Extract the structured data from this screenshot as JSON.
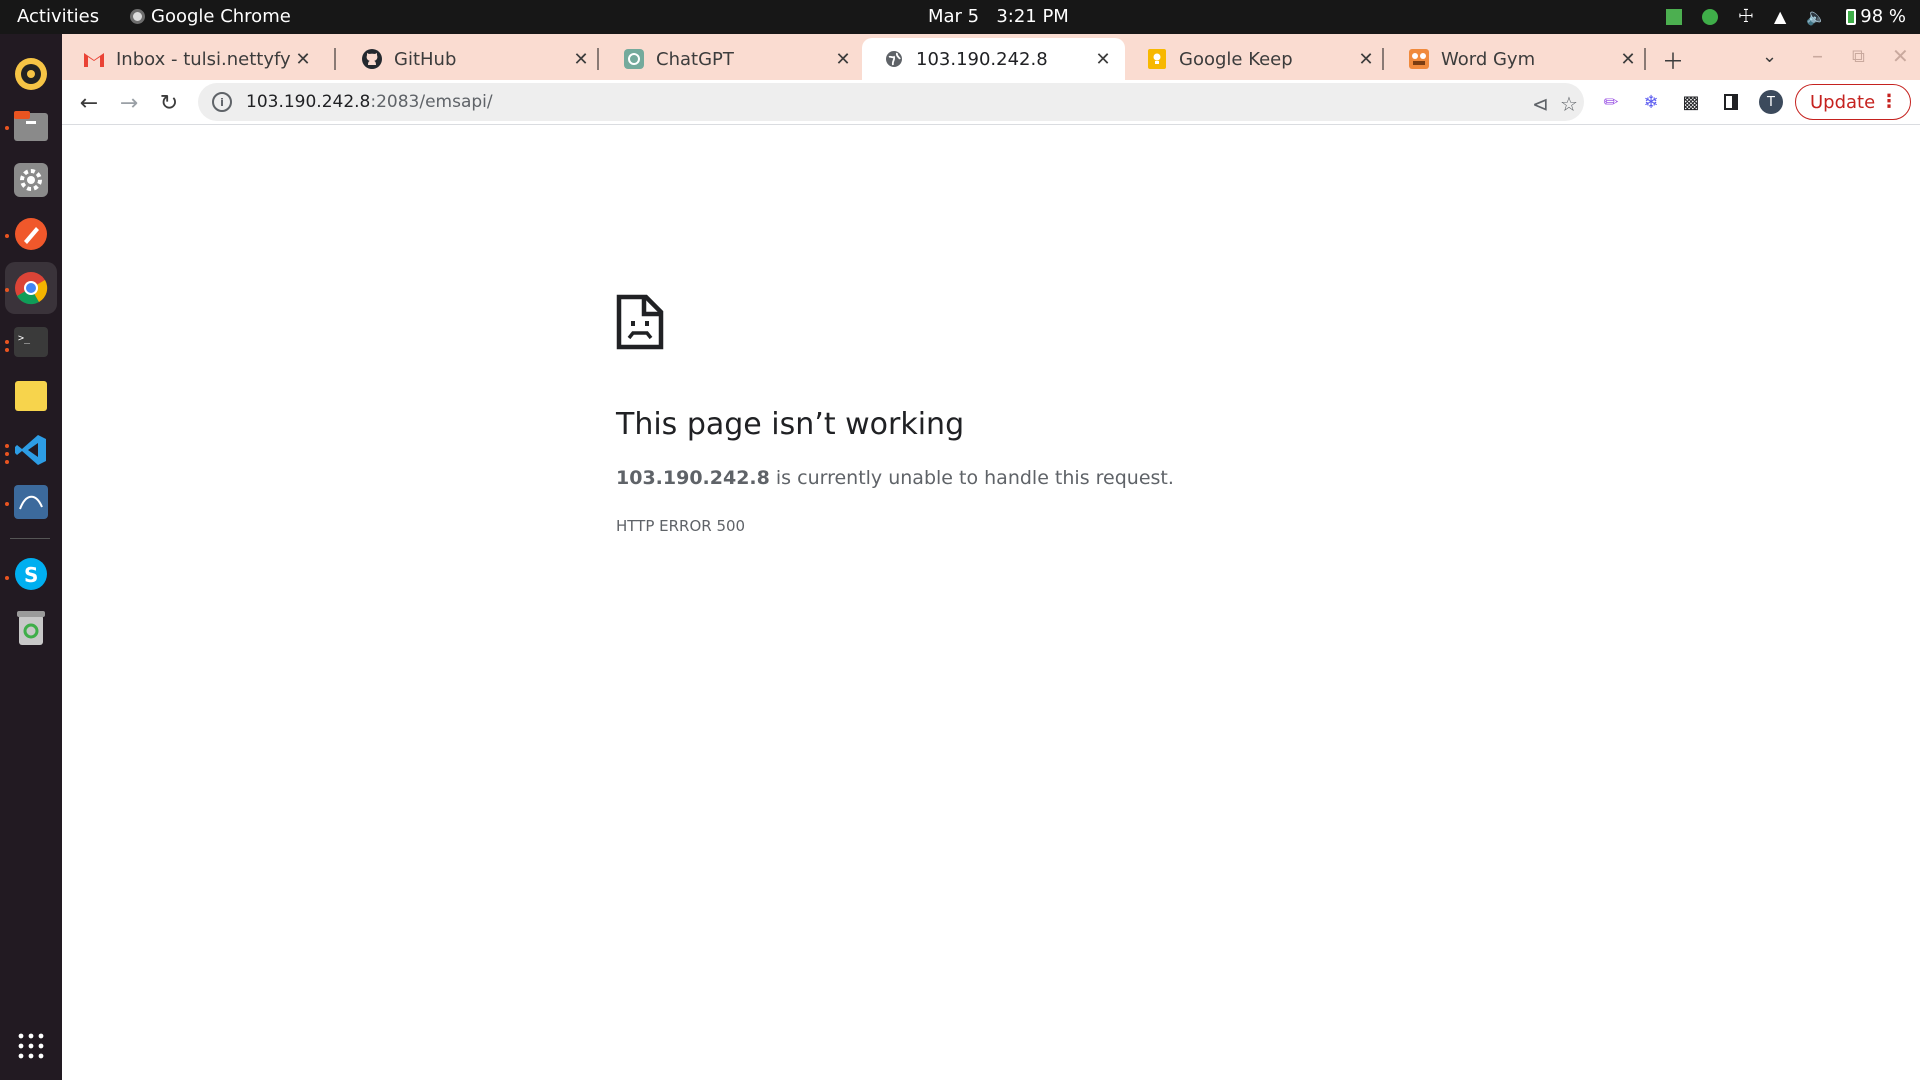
{
  "system_bar": {
    "activities": "Activities",
    "app_name": "Google Chrome",
    "date": "Mar 5",
    "time": "3:21 PM",
    "battery": "98 %"
  },
  "dock": {
    "apps": [
      "rhythmbox-icon",
      "files-icon",
      "settings-icon",
      "pen-app-icon",
      "chrome-icon",
      "terminal-icon",
      "notes-icon",
      "vscode-icon",
      "mysql-workbench-icon",
      "skype-icon",
      "trash-icon",
      "app-grid-icon"
    ]
  },
  "tabs": [
    {
      "title": "Inbox - tulsi.nettyfy@",
      "icon": "gmail-icon",
      "active": false
    },
    {
      "title": "GitHub",
      "icon": "github-icon",
      "active": false
    },
    {
      "title": "ChatGPT",
      "icon": "chatgpt-icon",
      "active": false
    },
    {
      "title": "103.190.242.8",
      "icon": "globe-icon",
      "active": true
    },
    {
      "title": "Google Keep",
      "icon": "keep-icon",
      "active": false
    },
    {
      "title": "Word Gym",
      "icon": "wordgym-icon",
      "active": false
    }
  ],
  "address_bar": {
    "host": "103.190.242.8",
    "rest": ":2083/emsapi/"
  },
  "profile_initial": "T",
  "update_label": "Update",
  "error_page": {
    "title": "This page isn’t working",
    "host": "103.190.242.8",
    "description": " is currently unable to handle this request.",
    "code": "HTTP ERROR 500"
  },
  "colors": {
    "tab_strip": "#fadcd1",
    "update_red": "#c5221f",
    "ubuntu_orange": "#e95420"
  }
}
